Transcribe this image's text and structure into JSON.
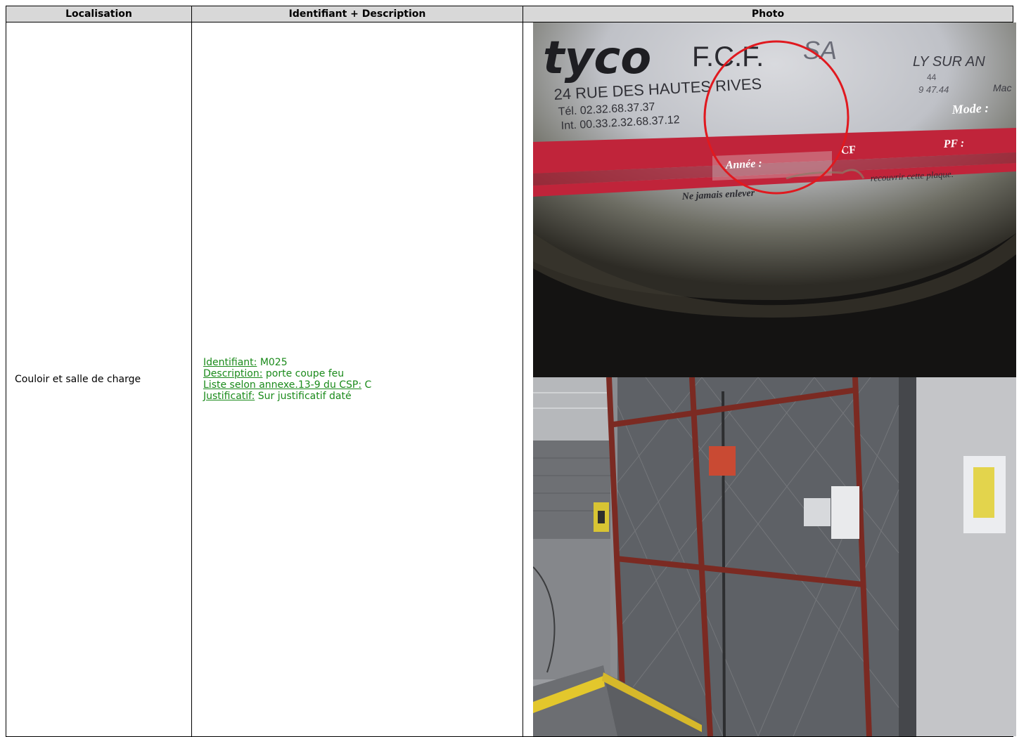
{
  "table": {
    "headers": [
      "Localisation",
      "Identifiant + Description",
      "Photo"
    ],
    "row": {
      "localisation": "Couloir et salle de charge",
      "fields": [
        {
          "label": "Identifiant:",
          "value": "M025"
        },
        {
          "label": "Description:",
          "value": "porte coupe feu"
        },
        {
          "label": "Liste selon annexe.13-9 du CSP:",
          "value": "C"
        },
        {
          "label": "Justificatif:",
          "value": "Sur justificatif daté"
        }
      ]
    }
  },
  "photo1": {
    "brand": "tyco",
    "company": "F.C.F.",
    "company_suffix": "SA",
    "address": "24 RUE DES HAUTES RIVES",
    "phone": "Tél. 02.32.68.37.37",
    "intl": "Int. 00.33.2.32.68.37.12",
    "right_city": "LY SUR AN",
    "right_num1": "44",
    "right_num2": "9 47.44",
    "right_label": "Mac",
    "mode_label": "Mode :",
    "annee_label": "Année :",
    "cf_label": "CF",
    "pf_label": "PF :",
    "warning_left": "Ne jamais enlever",
    "warning_right": "recouvrir cette plaque."
  },
  "colors": {
    "header_bg": "#d8d8d8",
    "green_text": "#1a8a1a",
    "plate_red": "#c0243a",
    "annotation_circle": "#e0191f"
  }
}
